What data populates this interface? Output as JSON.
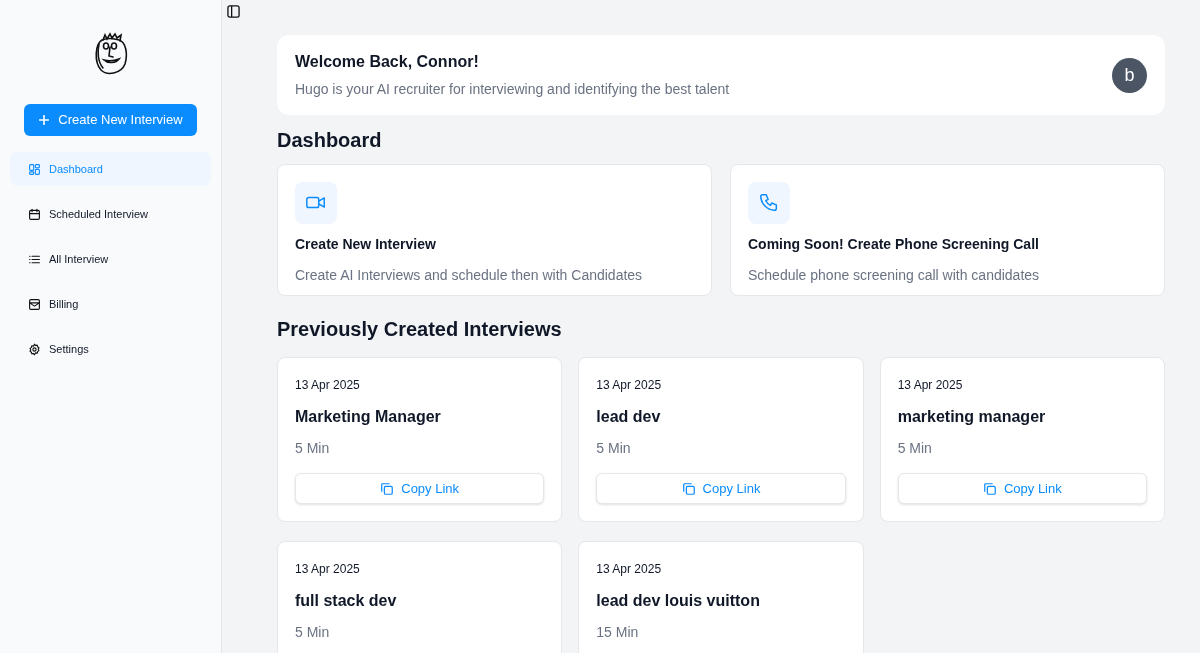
{
  "sidebar": {
    "create_button": "Create New Interview",
    "items": [
      {
        "label": "Dashboard",
        "selected": true
      },
      {
        "label": "Scheduled Interview",
        "selected": false
      },
      {
        "label": "All Interview",
        "selected": false
      },
      {
        "label": "Billing",
        "selected": false
      },
      {
        "label": "Settings",
        "selected": false
      }
    ]
  },
  "welcome": {
    "title": "Welcome Back, Connor!",
    "subtitle": "Hugo is your AI recruiter for interviewing and identifying the best talent",
    "avatar": "b"
  },
  "dashboard": {
    "heading": "Dashboard",
    "options": [
      {
        "title": "Create New Interview",
        "description": "Create AI Interviews and schedule then with Candidates"
      },
      {
        "title": "Coming Soon! Create Phone Screening Call",
        "description": "Schedule phone screening call with candidates"
      }
    ]
  },
  "interviews": {
    "heading": "Previously Created Interviews",
    "cards": [
      {
        "date": "13 Apr 2025",
        "title": "Marketing Manager",
        "duration": "5 Min",
        "button": "Copy Link"
      },
      {
        "date": "13 Apr 2025",
        "title": "lead dev",
        "duration": "5 Min",
        "button": "Copy Link"
      },
      {
        "date": "13 Apr 2025",
        "title": "marketing manager",
        "duration": "5 Min",
        "button": "Copy Link"
      },
      {
        "date": "13 Apr 2025",
        "title": "full stack dev",
        "duration": "5 Min"
      },
      {
        "date": "13 Apr 2025",
        "title": "lead dev louis vuitton",
        "duration": "15 Min"
      }
    ]
  }
}
